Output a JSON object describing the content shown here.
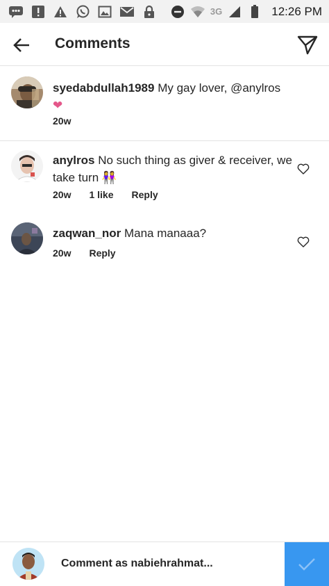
{
  "status_bar": {
    "time": "12:26 PM",
    "network": "3G",
    "icons": [
      "chat-icon",
      "alert-icon",
      "warning-icon",
      "whatsapp-icon",
      "image-icon",
      "mail-icon",
      "lock-icon",
      "do-not-disturb-icon",
      "wifi-icon",
      "signal-icon",
      "battery-icon"
    ]
  },
  "header": {
    "title": "Comments",
    "back_icon": "arrow-left-icon",
    "share_icon": "send-icon"
  },
  "caption": {
    "username": "syedabdullah1989",
    "text": "My gay lover, @anylros",
    "emoji": "❤",
    "time": "20w"
  },
  "comments": [
    {
      "username": "anylros",
      "text": "No such thing as giver & receiver, we take turn",
      "emoji": "👭",
      "time": "20w",
      "likes": "1 like",
      "reply": "Reply"
    },
    {
      "username": "zaqwan_nor",
      "text": "Mana manaaa?",
      "time": "20w",
      "reply": "Reply"
    }
  ],
  "footer": {
    "placeholder": "Comment as nabiehrahmat...",
    "post_icon": "checkmark-icon"
  },
  "colors": {
    "accent": "#3897f0",
    "heart": "#ed4956",
    "status_bar_bg": "#f2f2f2"
  }
}
